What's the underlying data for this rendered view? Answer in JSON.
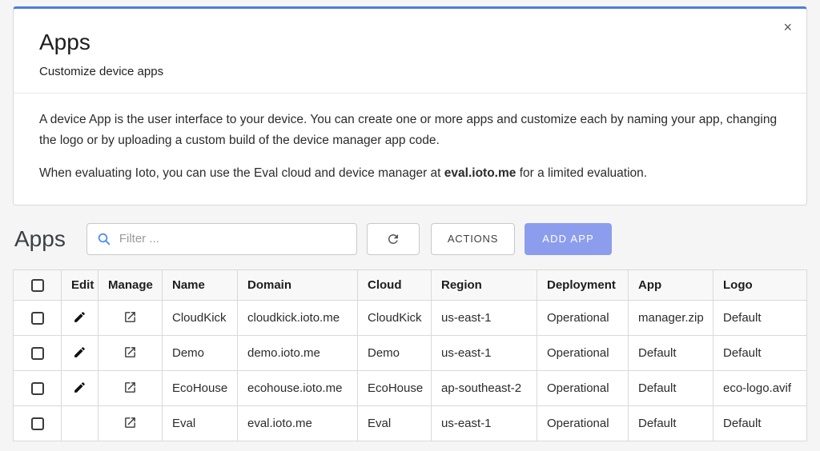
{
  "colors": {
    "accent_top_border": "#4a7de0",
    "primary_button": "#8c9ded",
    "search_icon": "#4285f4"
  },
  "modal": {
    "title": "Apps",
    "subtitle": "Customize device apps",
    "close_label": "×",
    "paragraph1": "A device App is the user interface to your device. You can create one or more apps and customize each by naming your app, changing the logo or by uploading a custom build of the device manager app code.",
    "paragraph2_prefix": "When evaluating Ioto, you can use the Eval cloud and device manager at ",
    "paragraph2_bold": "eval.ioto.me",
    "paragraph2_suffix": " for a limited evaluation."
  },
  "toolbar": {
    "heading": "Apps",
    "filter_placeholder": "Filter ...",
    "refresh_icon": "refresh-icon",
    "actions_label": "ACTIONS",
    "add_app_label": "ADD APP"
  },
  "table": {
    "headers": [
      "",
      "Edit",
      "Manage",
      "Name",
      "Domain",
      "Cloud",
      "Region",
      "Deployment",
      "App",
      "Logo"
    ],
    "icons": {
      "edit": "pencil-icon",
      "manage": "open-in-new-icon"
    },
    "rows": [
      {
        "can_edit": true,
        "name": "CloudKick",
        "domain": "cloudkick.ioto.me",
        "cloud": "CloudKick",
        "region": "us-east-1",
        "deployment": "Operational",
        "app": "manager.zip",
        "logo": "Default"
      },
      {
        "can_edit": true,
        "name": "Demo",
        "domain": "demo.ioto.me",
        "cloud": "Demo",
        "region": "us-east-1",
        "deployment": "Operational",
        "app": "Default",
        "logo": "Default"
      },
      {
        "can_edit": true,
        "name": "EcoHouse",
        "domain": "ecohouse.ioto.me",
        "cloud": "EcoHouse",
        "region": "ap-southeast-2",
        "deployment": "Operational",
        "app": "Default",
        "logo": "eco-logo.avif"
      },
      {
        "can_edit": false,
        "name": "Eval",
        "domain": "eval.ioto.me",
        "cloud": "Eval",
        "region": "us-east-1",
        "deployment": "Operational",
        "app": "Default",
        "logo": "Default"
      }
    ]
  }
}
